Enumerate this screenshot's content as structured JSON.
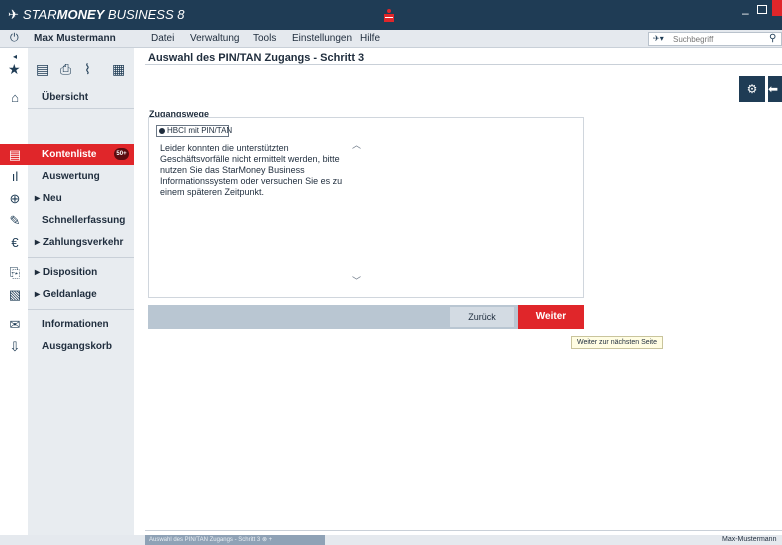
{
  "app": {
    "title": "STARMONEY BUSINESS 8",
    "title_prefix": "STAR",
    "title_strong": "MONEY",
    "title_rest": " BUSINESS 8"
  },
  "menubar": {
    "user": "Max Mustermann",
    "items": [
      "Datei",
      "Verwaltung",
      "Tools",
      "Einstellungen",
      "Hilfe"
    ],
    "search_placeholder": "Suchbegriff"
  },
  "sidebar": {
    "items": [
      {
        "label": "Übersicht",
        "icon": "home-icon"
      },
      {
        "label": "Kontenliste",
        "icon": "account-list-icon",
        "badge": "50+",
        "active": true
      },
      {
        "label": "Auswertung",
        "icon": "bar-chart-icon"
      },
      {
        "label": "Neu",
        "icon": "new-item-icon",
        "expandable": true
      },
      {
        "label": "Schnellerfassung",
        "icon": "edit-icon"
      },
      {
        "label": "Zahlungsverkehr",
        "icon": "payment-icon",
        "expandable": true
      },
      {
        "label": "Disposition",
        "icon": "disposition-icon",
        "expandable": true
      },
      {
        "label": "Geldanlage",
        "icon": "investment-icon",
        "expandable": true
      },
      {
        "label": "Informationen",
        "icon": "mail-icon"
      },
      {
        "label": "Ausgangskorb",
        "icon": "outbox-icon"
      }
    ]
  },
  "main": {
    "title": "Auswahl des PIN/TAN Zugangs - Schritt 3",
    "group_label": "Zugangswege",
    "radio_option": "HBCI mit PIN/TAN",
    "info_text": "Leider konnten die unterstützten Geschäftsvorfälle nicht ermittelt werden, bitte nutzen Sie das StarMoney Business Informationssystem oder versuchen Sie es zu einem späteren Zeitpunkt.",
    "back_label": "Zurück",
    "next_label": "Weiter",
    "tooltip": "Weiter zur nächsten Seite"
  },
  "statusbar": {
    "tab_label": "Auswahl des PIN/TAN Zugangs - Schritt 3",
    "user": "Max-Mustermann"
  },
  "colors": {
    "navy": "#1f3c55",
    "accent_red": "#e0262a"
  }
}
